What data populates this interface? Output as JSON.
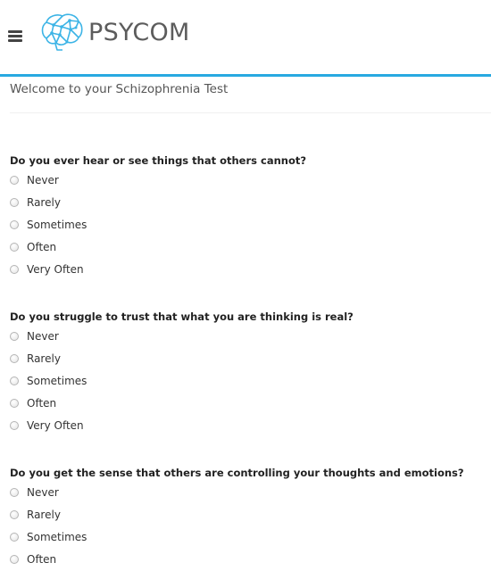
{
  "header": {
    "menu_icon": "hamburger-menu-icon",
    "logo_icon": "brain-network-icon",
    "logo_text": "PSYCOM",
    "accent_color": "#28a9e1"
  },
  "quiz": {
    "title": "Welcome to your Schizophrenia Test",
    "questions": [
      {
        "text": "Do you ever hear or see things that others cannot?",
        "options": [
          "Never",
          "Rarely",
          "Sometimes",
          "Often",
          "Very Often"
        ]
      },
      {
        "text": "Do you struggle to trust that what you are thinking is real?",
        "options": [
          "Never",
          "Rarely",
          "Sometimes",
          "Often",
          "Very Often"
        ]
      },
      {
        "text": "Do you get the sense that others are controlling your thoughts and emotions?",
        "options": [
          "Never",
          "Rarely",
          "Sometimes",
          "Often"
        ]
      }
    ]
  }
}
